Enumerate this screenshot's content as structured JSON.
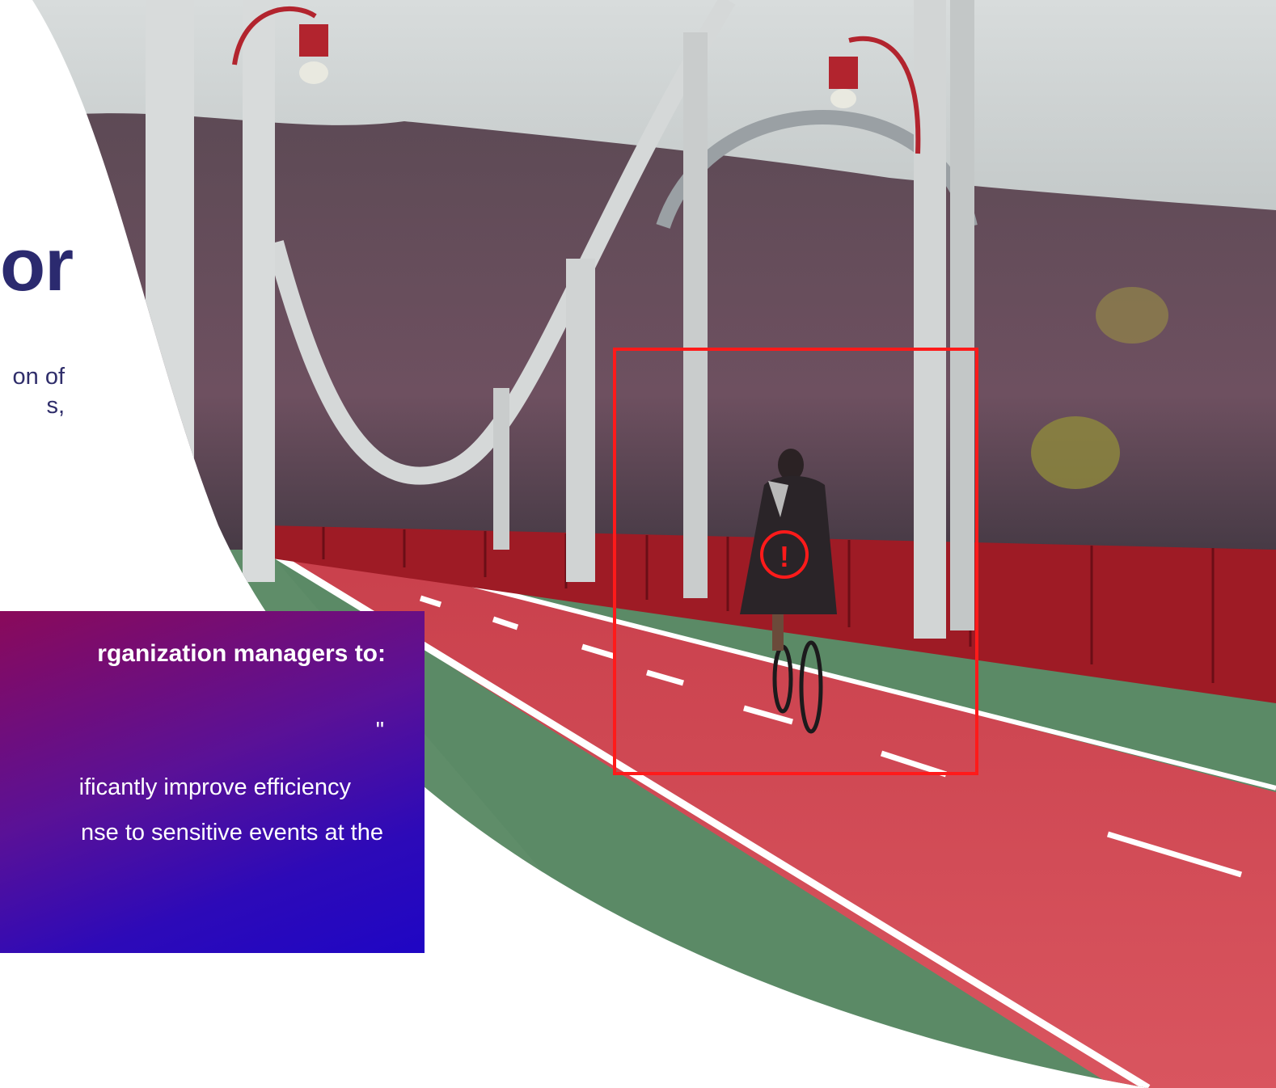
{
  "headline": {
    "fragment": "or"
  },
  "intro": {
    "line1": "on of",
    "line2": "s,"
  },
  "callout": {
    "title": "rganization managers to:",
    "line1": "\"",
    "line2": "ificantly improve efficiency",
    "line3": "nse to sensitive events at the"
  },
  "detection": {
    "alert_symbol": "!",
    "box_color": "#ff1a1a"
  },
  "colors": {
    "headline": "#2b2a6f",
    "gradient_start": "#8a0a5a",
    "gradient_end": "#1f06c4",
    "bike_lane": "#c8404b",
    "side_lane": "#5b8a66",
    "railing": "#9e1b25"
  },
  "icons": {
    "alert": "exclamation-circle-icon"
  }
}
